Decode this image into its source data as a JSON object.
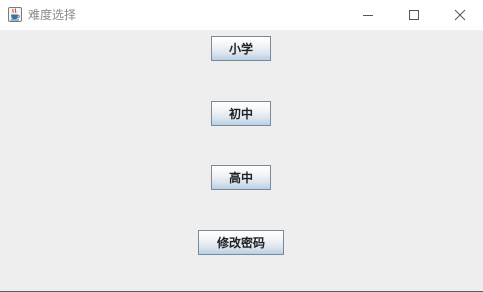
{
  "window": {
    "title": "难度选择",
    "app_icon": "java-cup-icon",
    "controls": {
      "minimize_icon": "minimize-icon",
      "maximize_icon": "maximize-icon",
      "close_icon": "close-icon"
    }
  },
  "buttons": {
    "primary": "小学",
    "junior": "初中",
    "senior": "高中",
    "change_password": "修改密码"
  }
}
